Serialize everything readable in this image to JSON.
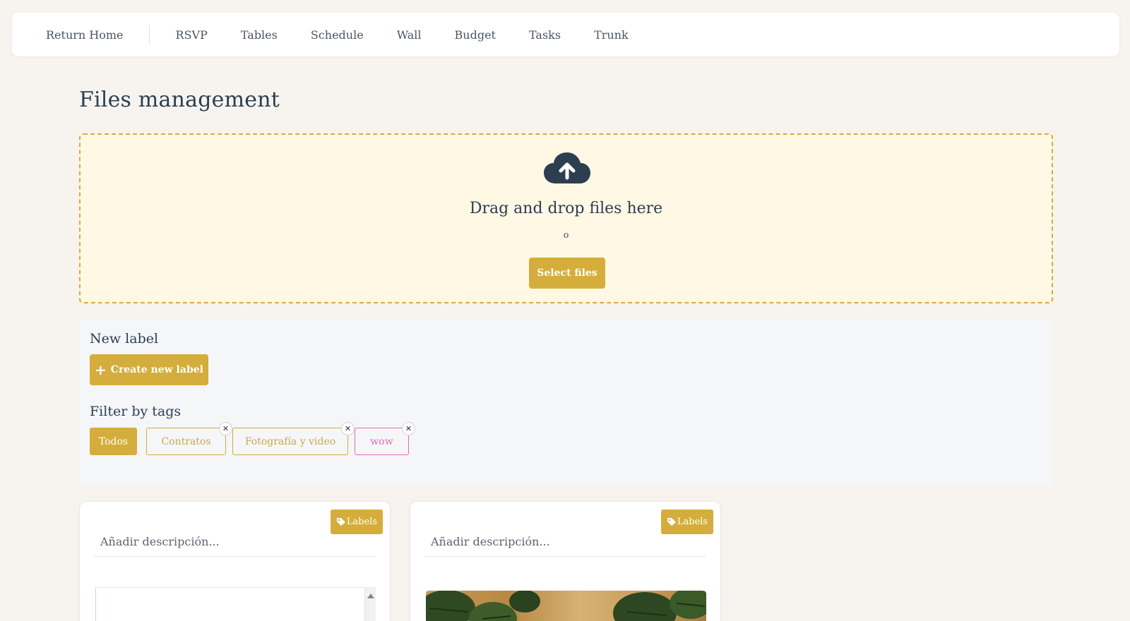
{
  "nav": {
    "home": "Return Home",
    "items": [
      "RSVP",
      "Tables",
      "Schedule",
      "Wall",
      "Budget",
      "Tasks",
      "Trunk"
    ]
  },
  "page": {
    "title": "Files management"
  },
  "dropzone": {
    "icon": "cloud-upload-icon",
    "text": "Drag and drop files here",
    "or": "o",
    "select_button": "Select files"
  },
  "labels_panel": {
    "new_label_heading": "New label",
    "create_button": "Create new label",
    "filter_heading": "Filter by tags",
    "tags": [
      {
        "label": "Todos",
        "active": true,
        "color": "#d4ad3c"
      },
      {
        "label": "Contratos",
        "active": false,
        "color": "#d4ad3c"
      },
      {
        "label": "Fotografía y video",
        "active": false,
        "color": "#d4ad3c"
      },
      {
        "label": "wow",
        "active": false,
        "color": "#e06db6"
      }
    ]
  },
  "cards": [
    {
      "labels_button": "Labels",
      "description_placeholder": "Añadir descripción...",
      "preview": "document"
    },
    {
      "labels_button": "Labels",
      "description_placeholder": "Añadir descripción...",
      "preview": "image"
    }
  ],
  "colors": {
    "accent": "#d4ad3c",
    "text": "#2c3e50",
    "background": "#f7f4f0",
    "dropzone_bg": "#fff8e4",
    "tag_pink": "#e06db6"
  }
}
